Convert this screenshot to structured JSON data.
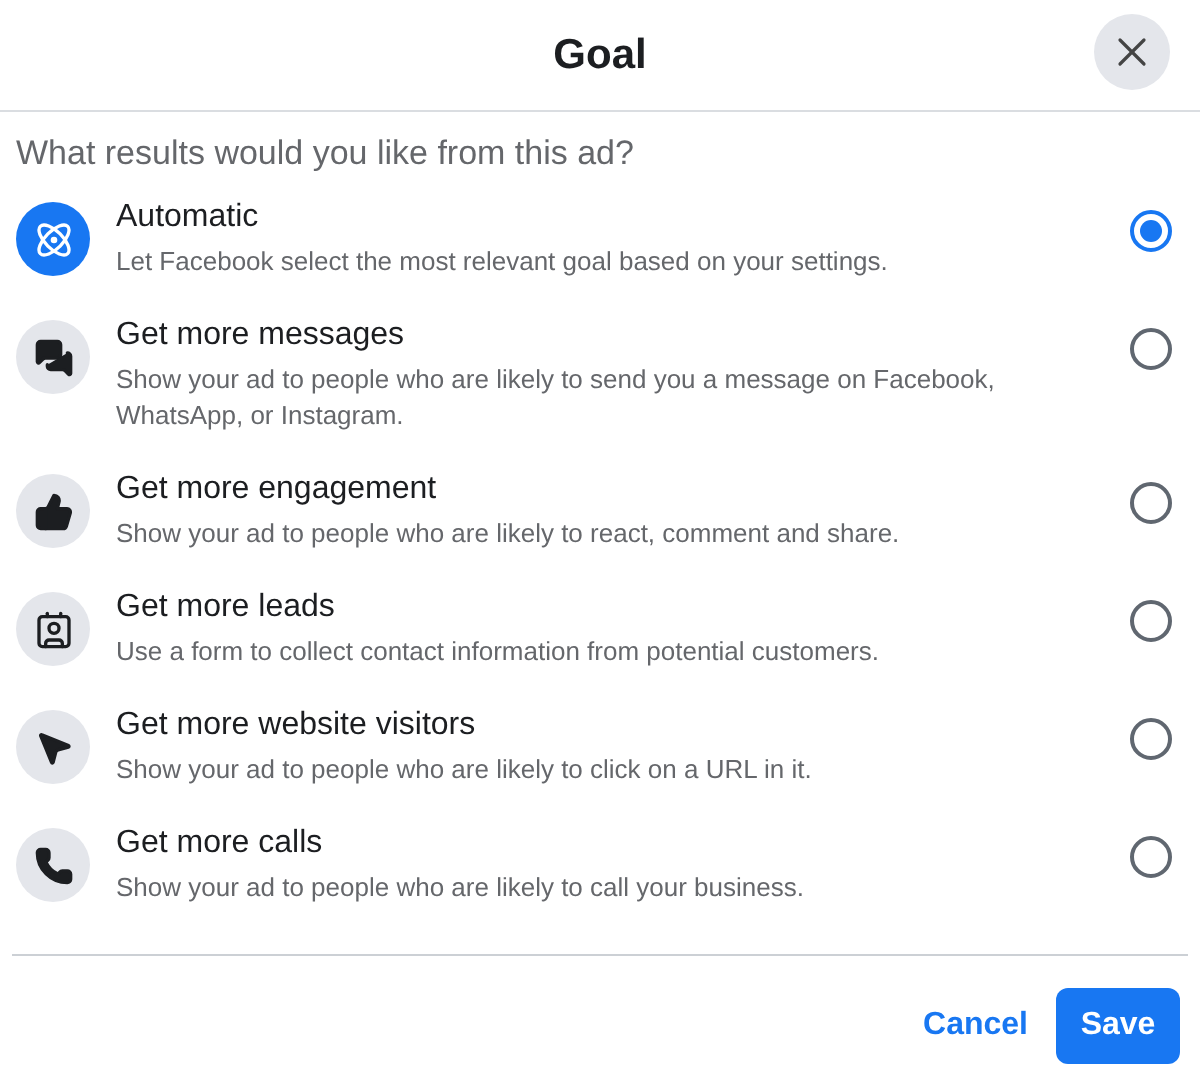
{
  "dialog": {
    "title": "Goal",
    "question": "What results would you like from this ad?"
  },
  "options": [
    {
      "kind": "automatic",
      "title": "Automatic",
      "description": "Let Facebook select the most relevant goal based on your settings.",
      "selected": true
    },
    {
      "kind": "messages",
      "title": "Get more messages",
      "description": "Show your ad to people who are likely to send you a message on Facebook, WhatsApp, or Instagram.",
      "selected": false
    },
    {
      "kind": "engagement",
      "title": "Get more engagement",
      "description": "Show your ad to people who are likely to react, comment and share.",
      "selected": false
    },
    {
      "kind": "leads",
      "title": "Get more leads",
      "description": "Use a form to collect contact information from potential customers.",
      "selected": false
    },
    {
      "kind": "visitors",
      "title": "Get more website visitors",
      "description": "Show your ad to people who are likely to click on a URL in it.",
      "selected": false
    },
    {
      "kind": "calls",
      "title": "Get more calls",
      "description": "Show your ad to people who are likely to call your business.",
      "selected": false
    }
  ],
  "footer": {
    "cancel": "Cancel",
    "save": "Save"
  }
}
